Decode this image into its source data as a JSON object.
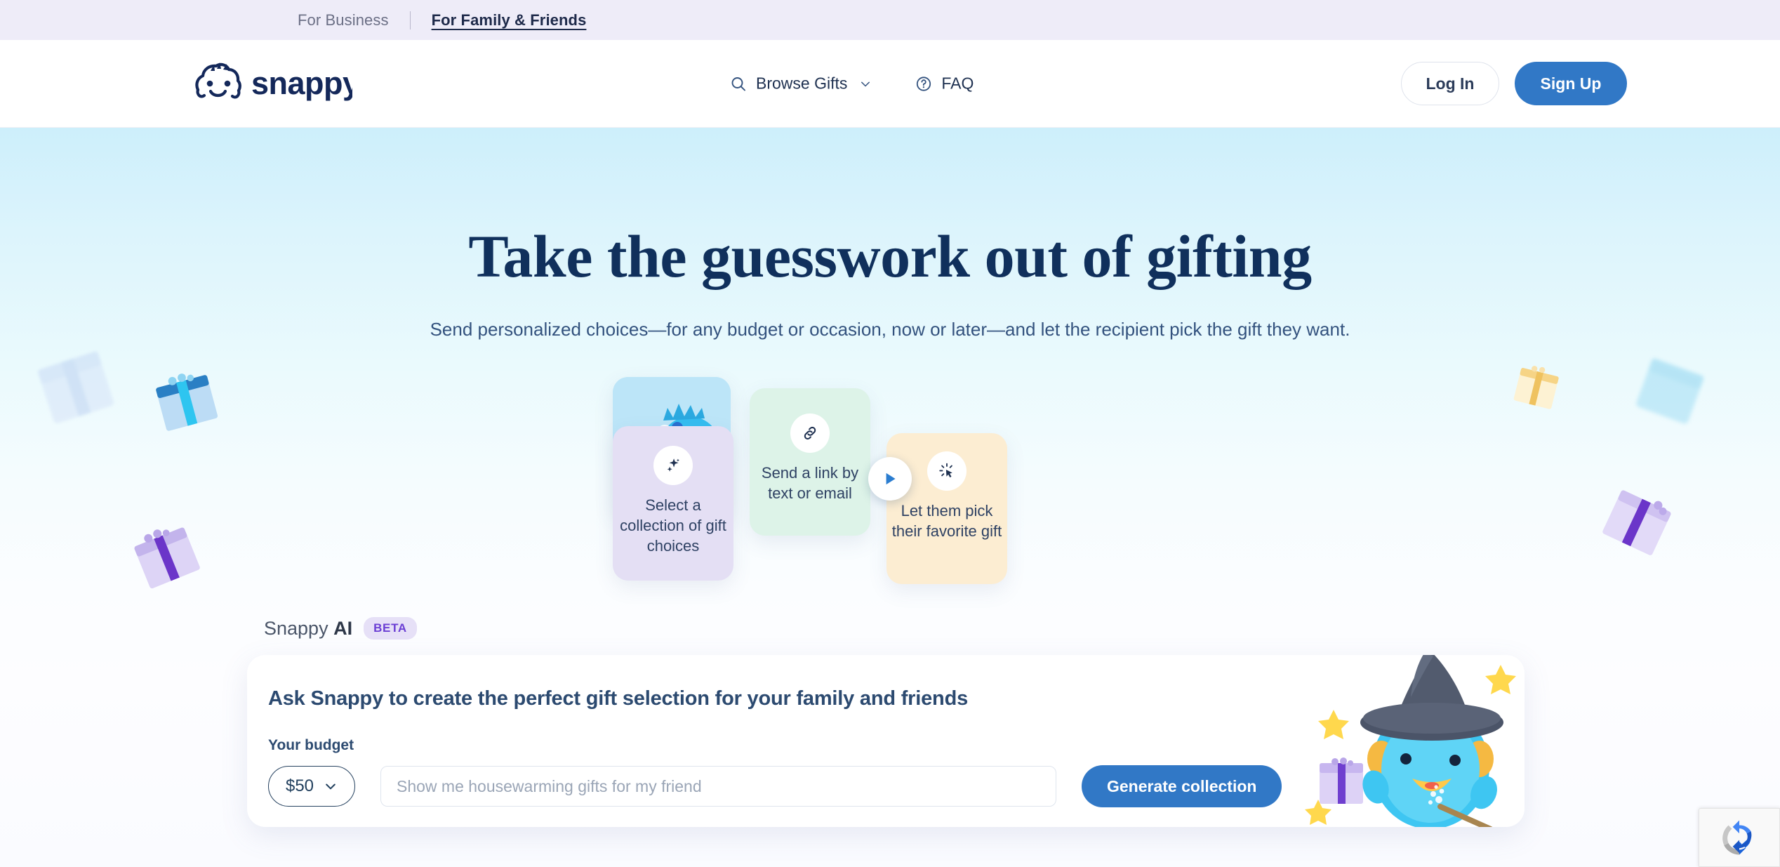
{
  "topbar": {
    "business_label": "For Business",
    "family_label": "For Family & Friends"
  },
  "header": {
    "logo_text": "snappy",
    "nav": [
      {
        "label": "Browse Gifts",
        "icon": "search-icon",
        "has_chevron": true
      },
      {
        "label": "FAQ",
        "icon": "question-circle-icon",
        "has_chevron": false
      }
    ],
    "login_label": "Log In",
    "signup_label": "Sign Up"
  },
  "hero": {
    "title": "Take the guesswork out of gifting",
    "subtitle": "Send personalized choices—for any budget or occasion, now or later—and let the recipient pick the gift they want.",
    "cards": [
      {
        "text": "Select a collection of gift choices",
        "icon": "sparkles-icon",
        "color": "#e4dff4"
      },
      {
        "text": "Send a link by text or email",
        "icon": "link-icon",
        "color": "#ddf3e8"
      },
      {
        "text": "Let them pick their favorite gift",
        "icon": "cursor-click-icon",
        "color": "#fcedd2"
      }
    ],
    "video_card": {
      "icon": "play-icon",
      "bg": "#bce5f8"
    }
  },
  "ai": {
    "label_plain": "Snappy ",
    "label_bold": "AI",
    "beta_badge": "BETA",
    "heading": "Ask Snappy to create the perfect gift selection for your family and friends",
    "budget_label": "Your budget",
    "budget_value": "$50",
    "prompt_placeholder": "Show me housewarming gifts for my friend",
    "prompt_value": "",
    "generate_label": "Generate collection"
  },
  "colors": {
    "accent_blue": "#3178c6",
    "navy": "#10305c",
    "topbar_bg": "#eeecf8",
    "beta_purple": "#6b3fd4"
  }
}
